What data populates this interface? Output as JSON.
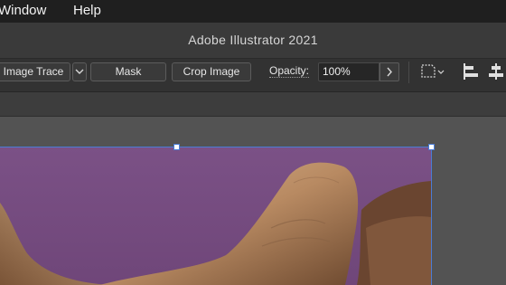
{
  "menubar": {
    "items": [
      "Window",
      "Help"
    ]
  },
  "titlebar": {
    "title": "Adobe Illustrator 2021"
  },
  "controlbar": {
    "image_trace_label": "Image Trace",
    "mask_label": "Mask",
    "crop_image_label": "Crop Image",
    "opacity_label": "Opacity:",
    "opacity_value": "100%",
    "icons": [
      "chevron-down-icon",
      "chevron-right-icon",
      "transform-icon",
      "align-left-icon",
      "align-center-icon"
    ]
  },
  "canvas": {
    "background_color": "#535353",
    "artwork_background": "#7a4f84",
    "selection_color": "#4a7cd6"
  }
}
